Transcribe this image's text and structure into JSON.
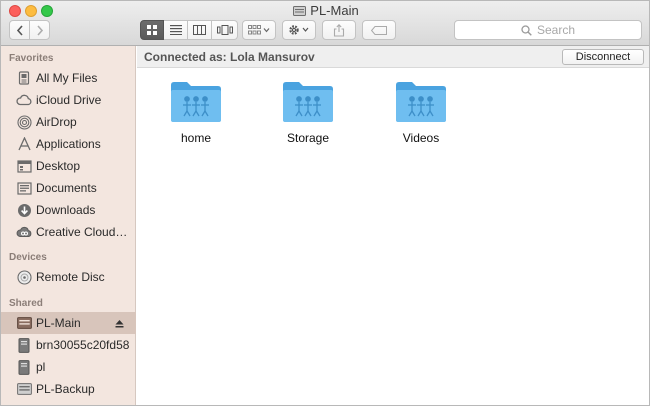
{
  "window": {
    "title": "PL-Main"
  },
  "toolbar": {
    "search_placeholder": "Search",
    "view_modes": [
      "icon-view",
      "list-view",
      "column-view",
      "cover-flow-view"
    ],
    "active_view": "icon-view"
  },
  "sidebar": {
    "sections": [
      {
        "header": "Favorites",
        "items": [
          {
            "label": "All My Files",
            "icon": "all-my-files-icon"
          },
          {
            "label": "iCloud Drive",
            "icon": "cloud-icon"
          },
          {
            "label": "AirDrop",
            "icon": "airdrop-icon"
          },
          {
            "label": "Applications",
            "icon": "applications-icon"
          },
          {
            "label": "Desktop",
            "icon": "desktop-icon"
          },
          {
            "label": "Documents",
            "icon": "documents-icon"
          },
          {
            "label": "Downloads",
            "icon": "downloads-icon"
          },
          {
            "label": "Creative Cloud…",
            "icon": "creative-cloud-icon"
          }
        ]
      },
      {
        "header": "Devices",
        "items": [
          {
            "label": "Remote Disc",
            "icon": "disc-icon"
          }
        ]
      },
      {
        "header": "Shared",
        "items": [
          {
            "label": "PL-Main",
            "icon": "server-icon",
            "selected": true,
            "eject": true
          },
          {
            "label": "brn30055c20fd58",
            "icon": "computer-icon"
          },
          {
            "label": "pl",
            "icon": "computer-icon"
          },
          {
            "label": "PL-Backup",
            "icon": "server-icon"
          }
        ]
      }
    ]
  },
  "main": {
    "connected_label": "Connected as: Lola Mansurov",
    "disconnect_label": "Disconnect",
    "folders": [
      {
        "name": "home"
      },
      {
        "name": "Storage"
      },
      {
        "name": "Videos"
      }
    ]
  },
  "colors": {
    "folder": "#6fbef0",
    "sidebar_bg": "#f3e6df",
    "selected_bg": "#d8c5bb"
  }
}
